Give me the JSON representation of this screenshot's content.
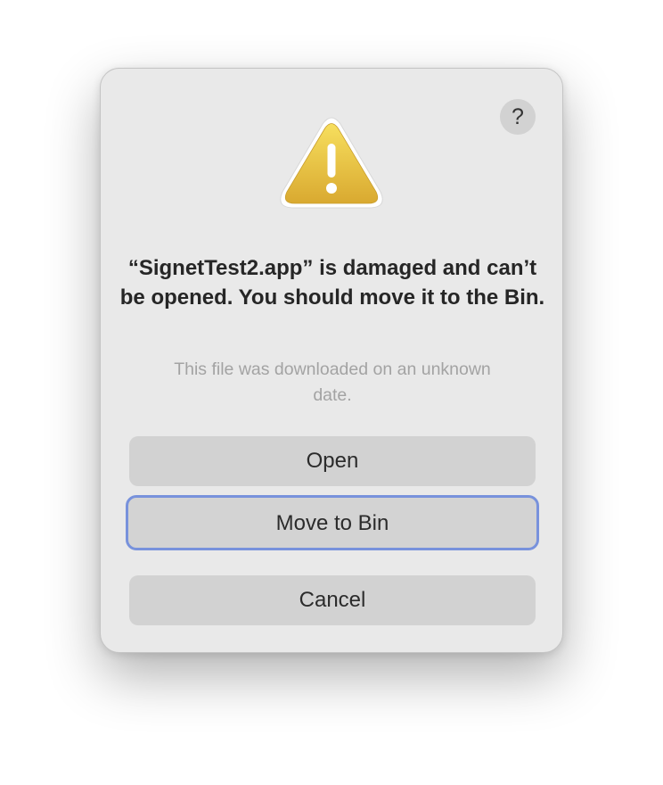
{
  "dialog": {
    "help_label": "?",
    "icon": "warning-icon",
    "title": "“SignetTest2.app” is damaged and can’t be opened. You should move it to the Bin.",
    "subtitle": "This file was downloaded on an unknown date.",
    "buttons": {
      "open": "Open",
      "move_to_bin": "Move to Bin",
      "cancel": "Cancel"
    }
  },
  "colors": {
    "dialog_bg": "#e9e9e9",
    "button_bg": "#d2d2d2",
    "focus_ring": "#7892dc",
    "warning_yellow": "#e7bd3a"
  }
}
